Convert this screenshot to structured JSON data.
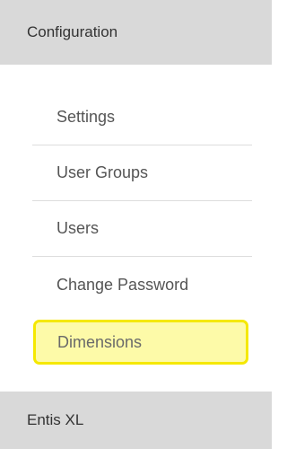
{
  "sections": {
    "configuration": {
      "label": "Configuration"
    },
    "entis": {
      "label": "Entis XL"
    }
  },
  "menu": {
    "items": [
      {
        "label": "Settings"
      },
      {
        "label": "User Groups"
      },
      {
        "label": "Users"
      },
      {
        "label": "Change Password"
      },
      {
        "label": "Dimensions"
      }
    ],
    "highlighted_item": "Dimensions",
    "highlight_color": "#fdfaa8",
    "highlight_border_color": "#f5e800"
  }
}
